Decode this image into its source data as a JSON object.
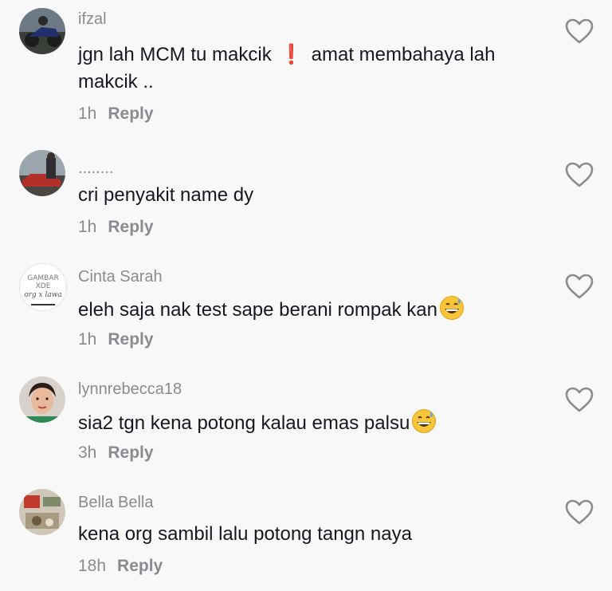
{
  "comments": [
    {
      "username": "ifzal",
      "text_before": "jgn lah MCM tu makcik",
      "text_after": "amat membahaya lah makcik ..",
      "exclaim": "❗",
      "time": "1h",
      "reply_label": "Reply"
    },
    {
      "username": "........",
      "text": "cri penyakit name dy",
      "time": "1h",
      "reply_label": "Reply"
    },
    {
      "username": "Cinta Sarah",
      "text": "eleh saja nak test sape berani rompak kan",
      "time": "1h",
      "reply_label": "Reply",
      "avatar_text": {
        "line1": "GAMBAR",
        "line2": "XDE",
        "line3": "org x lawa"
      }
    },
    {
      "username": "lynnrebecca18",
      "text": "sia2 tgn kena potong kalau emas palsu",
      "time": "3h",
      "reply_label": "Reply"
    },
    {
      "username": "Bella Bella",
      "text": "kena org sambil lalu potong tangn naya",
      "time": "18h",
      "reply_label": "Reply"
    }
  ],
  "icons": {
    "like": "heart-outline-icon",
    "emoji": "grinning-sweat-emoji"
  },
  "colors": {
    "background": "#f8f8f8",
    "username": "#8a8b91",
    "text": "#161823",
    "exclaim": "#e8292d"
  }
}
